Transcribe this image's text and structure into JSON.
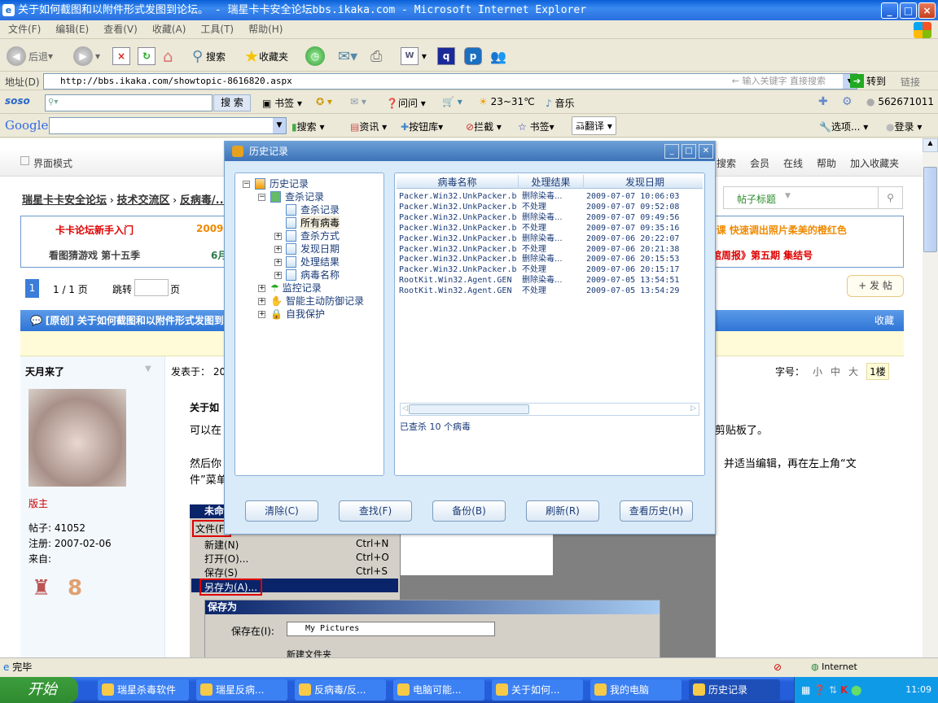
{
  "window": {
    "title": "关于如何截图和以附件形式发图到论坛。 - 瑞星卡卡安全论坛bbs.ikaka.com - Microsoft Internet Explorer"
  },
  "menu": [
    "文件(F)",
    "编辑(E)",
    "查看(V)",
    "收藏(A)",
    "工具(T)",
    "帮助(H)"
  ],
  "toolbar": {
    "back": "后退",
    "search": "搜索",
    "favorites": "收藏夹"
  },
  "address": {
    "label": "地址(D)",
    "url": "http://bbs.ikaka.com/showtopic-8616820.aspx",
    "hint": "输入关键字 直接搜索",
    "go": "转到",
    "links": "链接"
  },
  "soso": {
    "logo": "soso",
    "search_btn": "搜 索",
    "bookmarks": "书签",
    "ask": "问问",
    "weather": "23~31℃",
    "music": "音乐",
    "qq": "562671011"
  },
  "google": {
    "logo": "Google",
    "search": "搜索",
    "news": "资讯",
    "buttons": "按钮库",
    "block": "拦截",
    "bookmarks": "书签",
    "translate": "翻译",
    "options": "选项...",
    "login": "登录"
  },
  "forum": {
    "mode": "界面模式",
    "nav": [
      "搜索",
      "会员",
      "在线",
      "帮助",
      "加入收藏夹"
    ],
    "breadcrumb": [
      "瑞星卡卡安全论坛",
      "技术交流区",
      "反病毒/..."
    ],
    "search_type": "帖子标题",
    "announce": {
      "a1": "卡卡论坛新手入门",
      "a2": "2009",
      "a3": "第10课 快速调出照片柔美的橙红色",
      "b1": "看图猜游戏 第十五季",
      "b2": "6月",
      "b3": "馆周报》第五期 集结号"
    },
    "pager": {
      "current": "1",
      "total": "1 / 1 页",
      "jump": "跳转",
      "page": "页"
    },
    "post_button": "+ 发 帖",
    "post_title": "[原创] 关于如何截图和以附件形式发图到论坛。",
    "favorite": "收藏",
    "author": "天月来了",
    "posted": "发表于： 20",
    "font_size": {
      "label": "字号：",
      "small": "小",
      "mid": "中",
      "large": "大"
    },
    "floor": "1楼",
    "role": "版主",
    "posts": "帖子: 41052",
    "registered": "注册: 2007-02-06",
    "from": "来自:",
    "body": {
      "title": "关于如",
      "l1a": "可以在",
      "l1b": "剪贴板了。",
      "l2a": "然后你",
      "l2b": "并适当编辑，再在左上角“文",
      "l3": "件”菜单"
    },
    "embed": {
      "app": "未命",
      "file_menu": "文件(F)",
      "items": [
        {
          "label": "新建(N)",
          "key": "Ctrl+N"
        },
        {
          "label": "打开(O)...",
          "key": "Ctrl+O"
        },
        {
          "label": "保存(S)",
          "key": "Ctrl+S"
        },
        {
          "label": "另存为(A)...",
          "key": ""
        }
      ],
      "saveas_title": "保存为",
      "save_in": "保存在(I):",
      "folder": "My Pictures",
      "new_folder": "新建文件夹"
    }
  },
  "dialog": {
    "title": "历史记录",
    "tree": [
      "历史记录",
      "查杀记录",
      "查杀记录",
      "所有病毒",
      "查杀方式",
      "发现日期",
      "处理结果",
      "病毒名称",
      "监控记录",
      "智能主动防御记录",
      "自我保护"
    ],
    "columns": [
      "病毒名称",
      "处理结果",
      "发现日期"
    ],
    "rows": [
      [
        "Packer.Win32.UnkPacker.b",
        "删除染毒...",
        "2009-07-07 10:06:03"
      ],
      [
        "Packer.Win32.UnkPacker.b",
        "不处理",
        "2009-07-07 09:52:08"
      ],
      [
        "Packer.Win32.UnkPacker.b",
        "删除染毒...",
        "2009-07-07 09:49:56"
      ],
      [
        "Packer.Win32.UnkPacker.b",
        "不处理",
        "2009-07-07 09:35:16"
      ],
      [
        "Packer.Win32.UnkPacker.b",
        "删除染毒...",
        "2009-07-06 20:22:07"
      ],
      [
        "Packer.Win32.UnkPacker.b",
        "不处理",
        "2009-07-06 20:21:38"
      ],
      [
        "Packer.Win32.UnkPacker.b",
        "删除染毒...",
        "2009-07-06 20:15:53"
      ],
      [
        "Packer.Win32.UnkPacker.b",
        "不处理",
        "2009-07-06 20:15:17"
      ],
      [
        "RootKit.Win32.Agent.GEN",
        "删除染毒...",
        "2009-07-05 13:54:51"
      ],
      [
        "RootKit.Win32.Agent.GEN",
        "不处理",
        "2009-07-05 13:54:29"
      ]
    ],
    "summary": "已查杀 10 个病毒",
    "buttons": [
      "清除(C)",
      "查找(F)",
      "备份(B)",
      "刷新(R)",
      "查看历史(H)"
    ]
  },
  "status": {
    "text": "完毕",
    "zone": "Internet"
  },
  "taskbar": {
    "start": "开始",
    "tasks": [
      "瑞星杀毒软件",
      "瑞星反病...",
      "反病毒/反...",
      "电脑可能...",
      "关于如何...",
      "我的电脑",
      "历史记录"
    ],
    "clock": "11:09"
  }
}
